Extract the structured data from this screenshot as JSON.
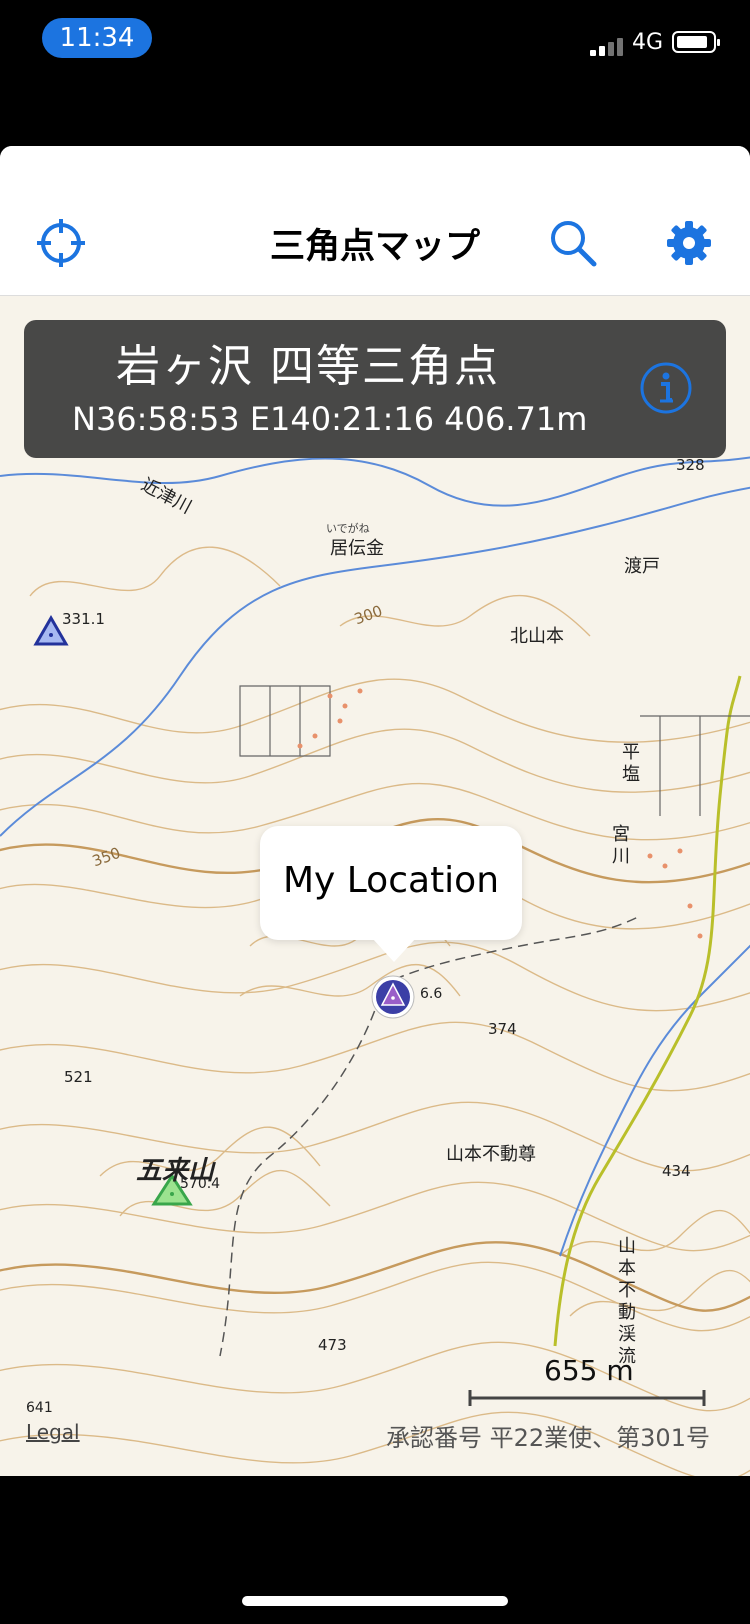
{
  "status_bar": {
    "time": "11:34",
    "network": "4G"
  },
  "nav": {
    "title": "三角点マップ"
  },
  "callout": {
    "title": "岩ヶ沢  四等三角点",
    "coords": "N36:58:53 E140:21:16 406.71m"
  },
  "popup": {
    "label": "My Location"
  },
  "map_labels": {
    "river": "近津川",
    "village1": "居伝金",
    "village2": "渡戸",
    "village3": "北山本",
    "village4": "平\n塩",
    "river2": "宮\n川",
    "peak_name": "五来山",
    "peak_elev": "570.4",
    "shrine": "山本不動尊",
    "stream": "山\n本\n不\n動\n渓\n流",
    "e328": "328",
    "e331": "331.1",
    "e300": "300",
    "e350": "350",
    "e374": "374",
    "e521": "521",
    "e434": "434",
    "e473": "473",
    "e641": "641",
    "pin_elev": "6.6",
    "furigana": "いでがね"
  },
  "scale": {
    "label": "655 m"
  },
  "legal": "Legal",
  "copyright": "承認番号 平22業使、第301号",
  "colors": {
    "accent": "#1c74e0",
    "callout_bg": "#303030",
    "map_bg": "#f7f3ea"
  },
  "icons": {
    "locate": "crosshair-icon",
    "search": "search-icon",
    "settings": "gear-icon",
    "info": "info-icon"
  }
}
